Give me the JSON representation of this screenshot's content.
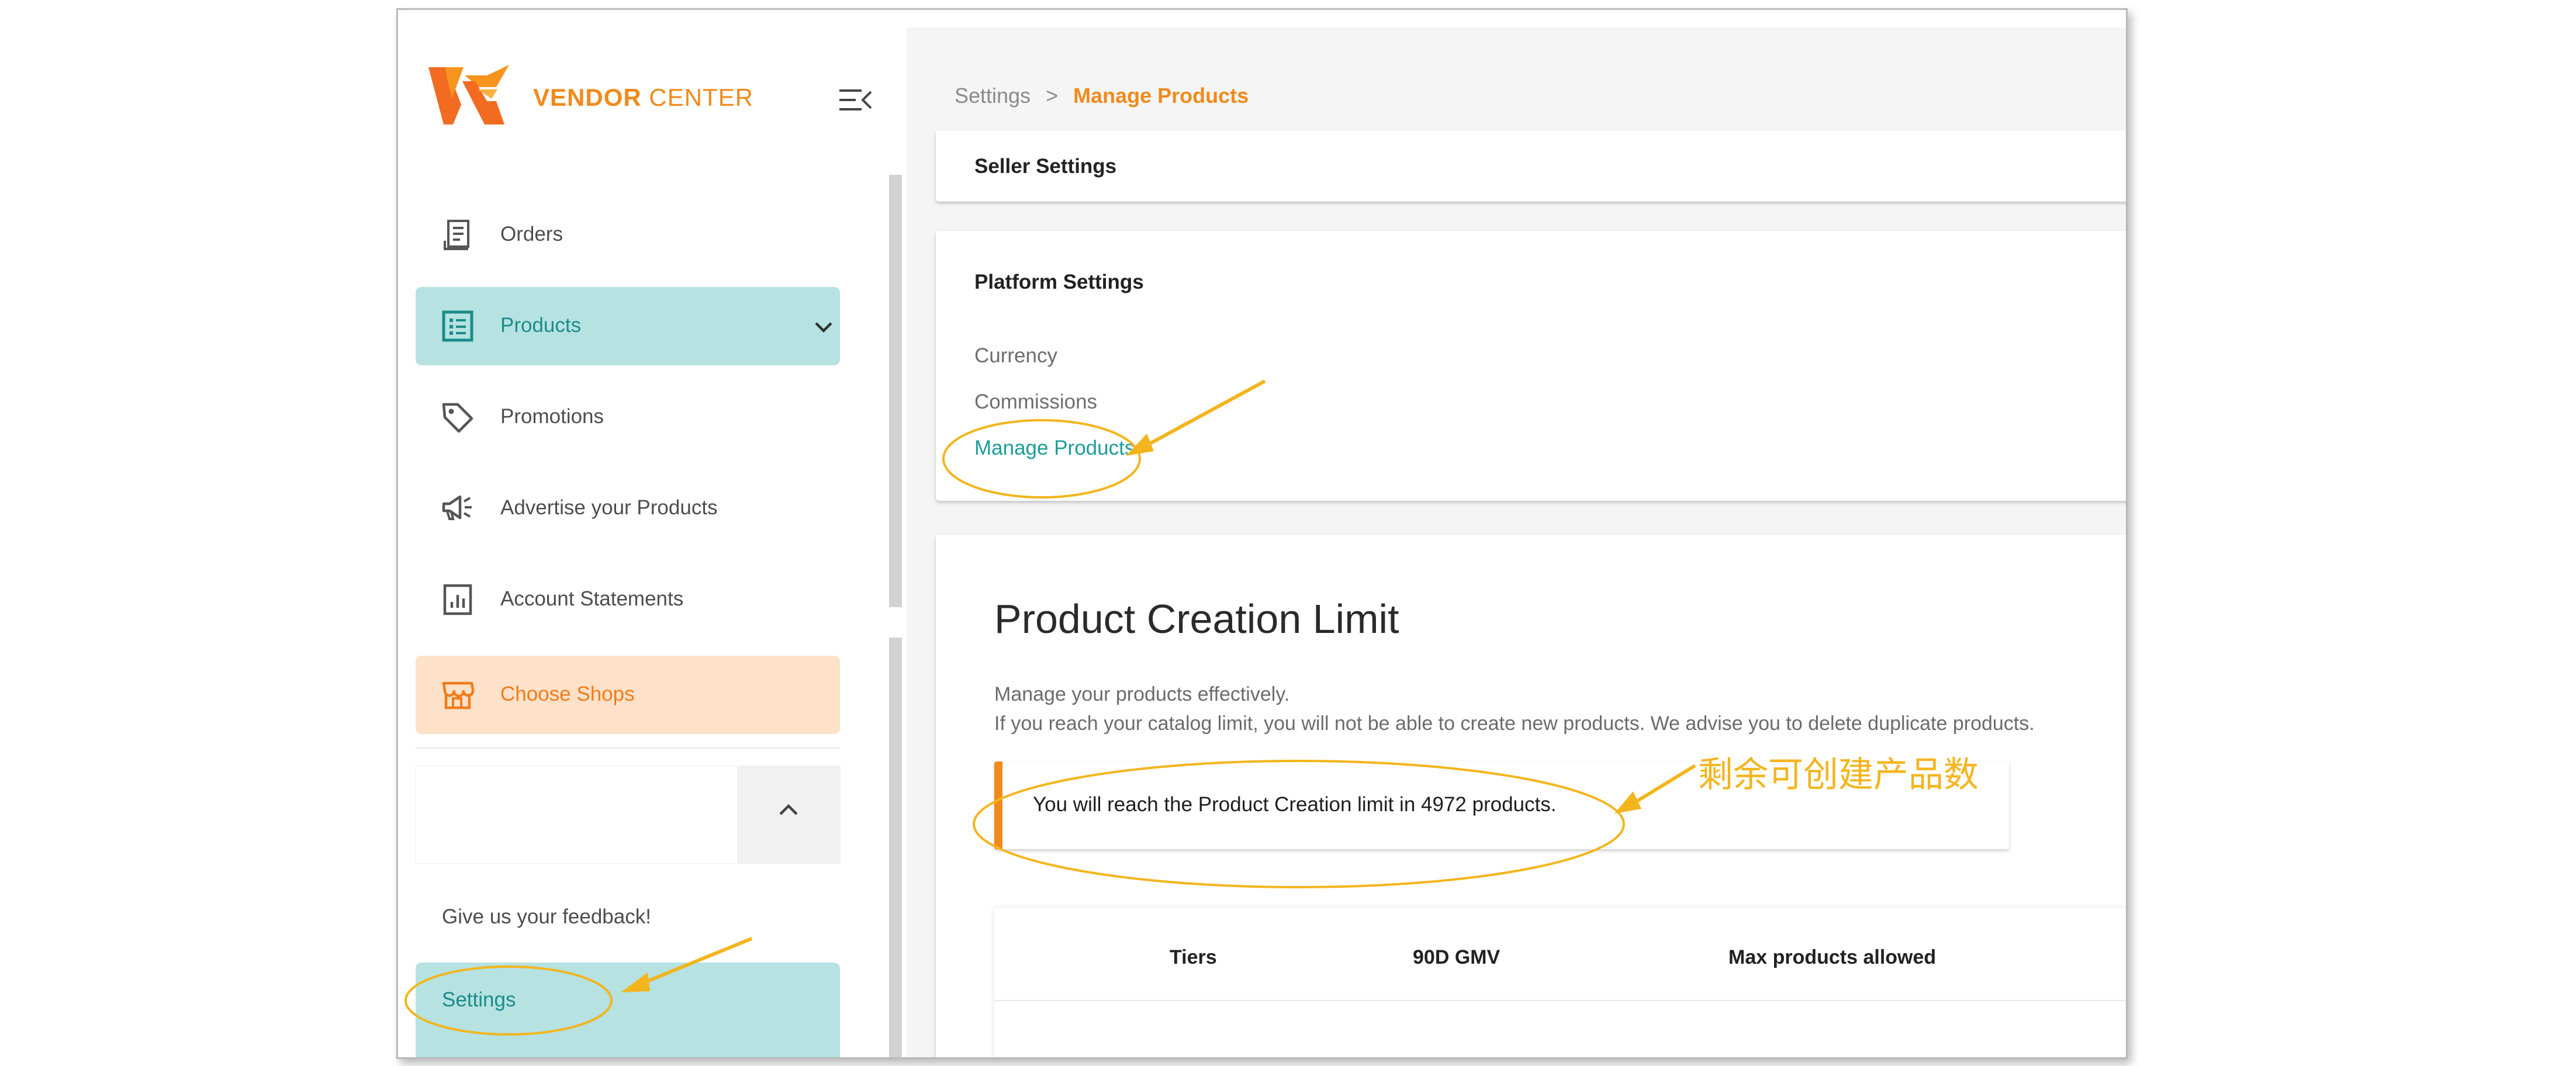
{
  "brand": {
    "name_bold": "VENDOR",
    "name_rest": " CENTER"
  },
  "sidebar": {
    "items": [
      {
        "label": "Orders",
        "icon": "orders-icon"
      },
      {
        "label": "Products",
        "icon": "products-list-icon",
        "active": true
      },
      {
        "label": "Promotions",
        "icon": "tag-icon"
      },
      {
        "label": "Advertise your Products",
        "icon": "megaphone-icon"
      },
      {
        "label": "Account Statements",
        "icon": "statement-chart-icon"
      },
      {
        "label": "Choose Shops",
        "icon": "shop-icon"
      }
    ],
    "feedback": "Give us your feedback!",
    "settings": "Settings"
  },
  "breadcrumb": {
    "parent": "Settings",
    "separator": ">",
    "current": "Manage Products"
  },
  "seller_settings": {
    "title": "Seller Settings"
  },
  "platform_settings": {
    "title": "Platform Settings",
    "links": [
      "Currency",
      "Commissions",
      "Manage Products"
    ]
  },
  "limit": {
    "title": "Product Creation Limit",
    "desc1": "Manage your products effectively.",
    "desc2": "If you reach your catalog limit, you will not be able to create new products. We advise you to delete duplicate products.",
    "alert": "You will reach the Product Creation limit in 4972 products.",
    "table_headers": [
      "Tiers",
      "90D GMV",
      "Max products allowed"
    ]
  },
  "annotation": {
    "note": "剩余可创建产品数"
  },
  "colors": {
    "accent": "#f08a1c",
    "teal": "#1a9c9a",
    "active_bg": "#b6e2e1",
    "annotation": "#f3b51d"
  }
}
